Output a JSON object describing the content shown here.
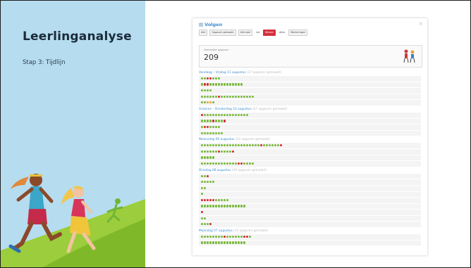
{
  "slide": {
    "title": "Leerlinganalyse",
    "subtitle": "Stap 3: Tijdlijn"
  },
  "card": {
    "title": "Volgen",
    "toolbar": [
      "Alle",
      "Opgaven gemaakt",
      "Alle doel",
      "tot",
      "Wissen",
      "Alles",
      "Markeringen"
    ],
    "stat_label": "Gemaakte opgaven",
    "stat_value": "209"
  },
  "sections": [
    {
      "date": "Vandaag – Vrijdag 11 augustus",
      "count": "(27 opgaven gemaakt)",
      "rows": [
        "ggrrggg",
        "grrgggggggggggg",
        "gggg",
        "ggggggrgggggggggggg",
        "ggoog"
      ]
    },
    {
      "date": "Gisteren – Donderdag 10 augustus",
      "count": "(47 opgaven gemaakt)",
      "rows": [
        "rgggggggggggggggg",
        "ggggrgggr",
        "grrgggg",
        "gggggggg"
      ]
    },
    {
      "date": "Woensdag 09 augustus",
      "count": "(53 opgaven gemaakt)",
      "rows": [
        "gggggggggggggggggggggrggggggr",
        "ggggggrggggr",
        "ggggg",
        "gggggggggggggrrgggg"
      ]
    },
    {
      "date": "Dinsdag 08 augustus",
      "count": "(49 opgaven gemaakt)",
      "rows": [
        "ggr",
        "ggggg",
        "gg",
        "g",
        "rrrrrggggg",
        "gggggggggggggggg",
        "r",
        "gg",
        "gggr"
      ]
    },
    {
      "date": "Maandag 07 augustus",
      "count": "(33 opgaven gemaakt)",
      "rows": [
        "ggggggggrggggggrrg",
        "gggggggggggggggg"
      ]
    }
  ]
}
